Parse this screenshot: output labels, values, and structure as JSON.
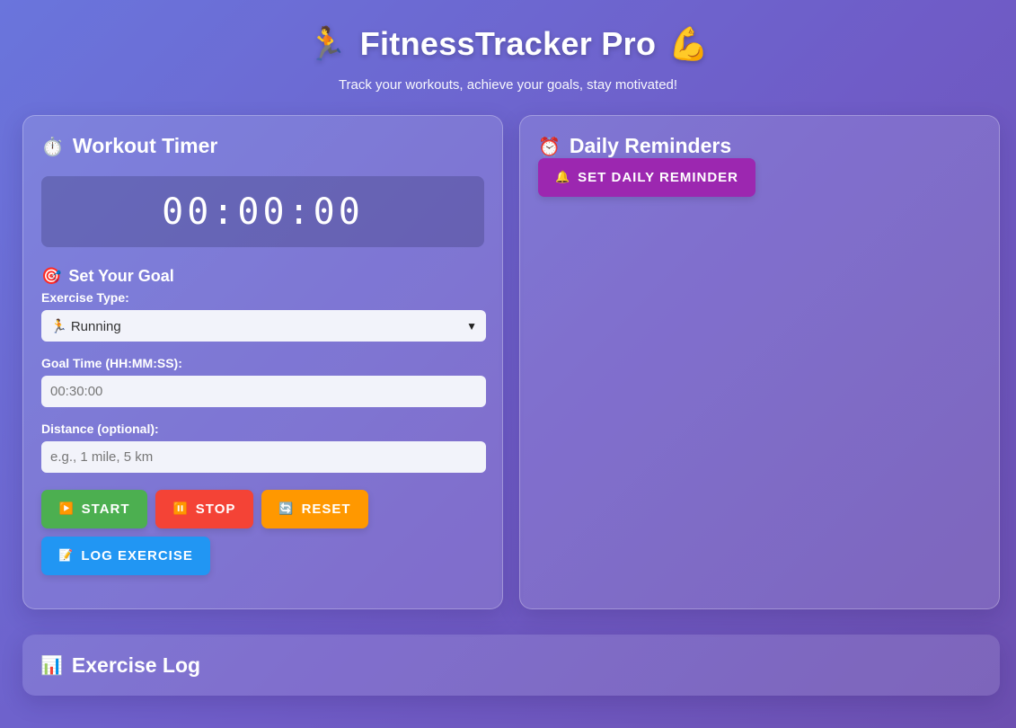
{
  "header": {
    "title": "FitnessTracker Pro",
    "title_left_emoji": "🏃",
    "title_right_emoji": "💪",
    "subtitle": "Track your workouts, achieve your goals, stay motivated!"
  },
  "timer_card": {
    "title": "Workout Timer",
    "icon": "⏱️",
    "display": "00:00:00"
  },
  "goal": {
    "title": "Set Your Goal",
    "icon": "🎯",
    "exercise_label": "Exercise Type:",
    "exercise_value": "🏃 Running",
    "goal_time_label": "Goal Time (HH:MM:SS):",
    "goal_time_value": "00:30:00",
    "distance_label": "Distance (optional):",
    "distance_placeholder": "e.g., 1 mile, 5 km"
  },
  "buttons": {
    "start": "START",
    "start_icon": "▶️",
    "stop": "STOP",
    "stop_icon": "⏸️",
    "reset": "RESET",
    "reset_icon": "🔄",
    "log": "LOG EXERCISE",
    "log_icon": "📝"
  },
  "reminders_card": {
    "title": "Daily Reminders",
    "icon": "⏰",
    "button": "SET DAILY REMINDER",
    "button_icon": "🔔"
  },
  "log_card": {
    "title": "Exercise Log",
    "icon": "📊"
  },
  "colors": {
    "start": "#4caf50",
    "stop": "#f44336",
    "reset": "#ff9800",
    "log": "#2196f3",
    "reminder": "#9c27b0"
  }
}
